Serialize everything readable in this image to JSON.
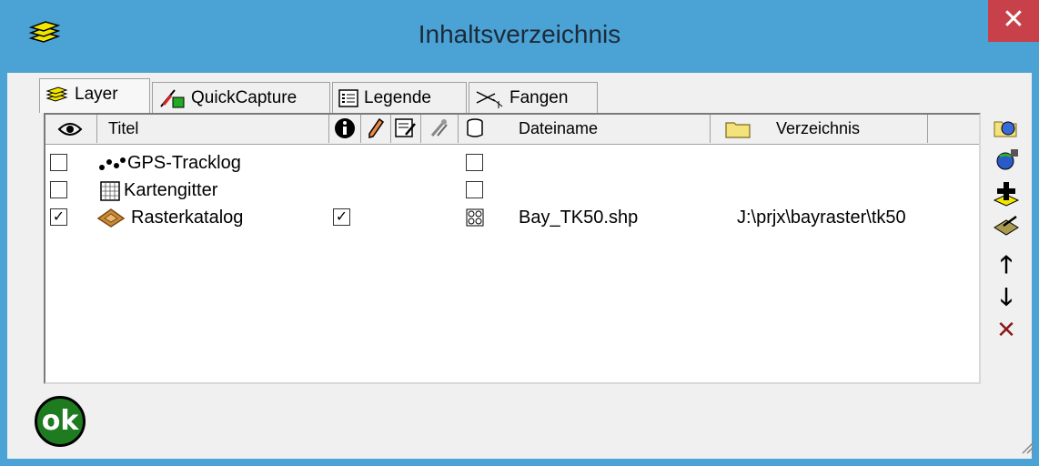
{
  "window": {
    "title": "Inhaltsverzeichnis",
    "close_glyph": "✕"
  },
  "tabs": [
    {
      "label": "Layer",
      "icon": "layers-icon"
    },
    {
      "label": "QuickCapture",
      "icon": "quickcapture-icon"
    },
    {
      "label": "Legende",
      "icon": "legend-icon"
    },
    {
      "label": "Fangen",
      "icon": "snap-icon"
    }
  ],
  "columns": {
    "title": "Titel",
    "filename": "Dateiname",
    "directory": "Verzeichnis"
  },
  "rows": [
    {
      "visible": false,
      "title": "GPS-Tracklog",
      "info": null,
      "extra": false,
      "filename": "",
      "directory": ""
    },
    {
      "visible": false,
      "title": "Kartengitter",
      "info": null,
      "extra": false,
      "filename": "",
      "directory": ""
    },
    {
      "visible": true,
      "title": "Rasterkatalog",
      "info": true,
      "extra": "pattern",
      "filename": "Bay_TK50.shp",
      "directory": "J:\\prjx\\bayraster\\tk50"
    }
  ],
  "check_glyph": "✓",
  "side_buttons": {
    "up": "🡑",
    "down": "🡓",
    "remove": "✕",
    "add": "+"
  },
  "ok_label": "ok",
  "colors": {
    "titlebar": "#4aa3d4",
    "close": "#c7404a",
    "ok": "#1e7b20"
  }
}
